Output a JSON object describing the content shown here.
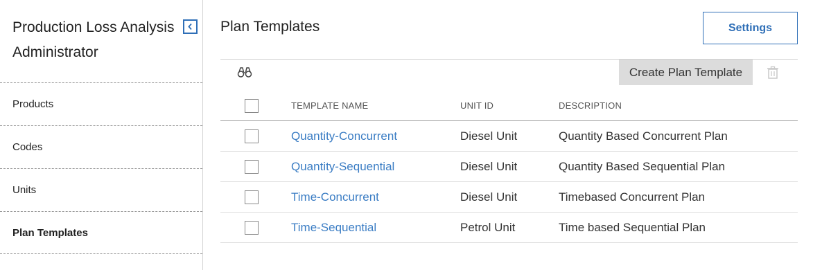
{
  "sidebar": {
    "app_title": "Production Loss Analysis Administrator",
    "items": [
      {
        "label": "Products"
      },
      {
        "label": "Codes"
      },
      {
        "label": "Units"
      },
      {
        "label": "Plan Templates"
      }
    ]
  },
  "main": {
    "page_title": "Plan Templates",
    "settings_label": "Settings",
    "create_label": "Create Plan Template",
    "columns": {
      "name": "TEMPLATE NAME",
      "unit": "UNIT ID",
      "description": "DESCRIPTION"
    },
    "rows": [
      {
        "name": "Quantity-Concurrent",
        "unit": "Diesel Unit",
        "description": "Quantity Based Concurrent Plan"
      },
      {
        "name": "Quantity-Sequential",
        "unit": "Diesel Unit",
        "description": "Quantity Based Sequential Plan"
      },
      {
        "name": "Time-Concurrent",
        "unit": "Diesel Unit",
        "description": "Timebased Concurrent Plan"
      },
      {
        "name": "Time-Sequential",
        "unit": "Petrol Unit",
        "description": "Time based Sequential Plan"
      }
    ]
  },
  "icons": {
    "collapse": "chevron-left-icon",
    "search": "binoculars-icon",
    "delete": "trash-icon"
  },
  "colors": {
    "accent": "#2f6fb7",
    "link": "#3b7dc4",
    "create_button_bg": "#dcdcdc"
  }
}
